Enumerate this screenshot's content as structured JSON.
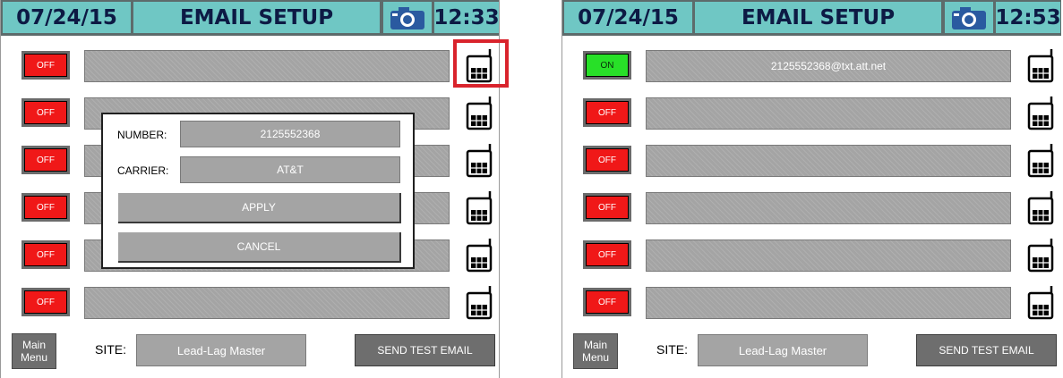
{
  "left": {
    "header": {
      "date": "07/24/15",
      "title": "EMAIL SETUP",
      "time": "12:33",
      "camera_icon": "camera-icon"
    },
    "rows": [
      {
        "state": "OFF",
        "value": ""
      },
      {
        "state": "OFF",
        "value": ""
      },
      {
        "state": "OFF",
        "value": ""
      },
      {
        "state": "OFF",
        "value": ""
      },
      {
        "state": "OFF",
        "value": ""
      },
      {
        "state": "OFF",
        "value": ""
      }
    ],
    "dialog": {
      "number_label": "NUMBER:",
      "number_value": "2125552368",
      "carrier_label": "CARRIER:",
      "carrier_value": "AT&T",
      "apply_label": "APPLY",
      "cancel_label": "CANCEL"
    },
    "footer": {
      "main_menu_line1": "Main",
      "main_menu_line2": "Menu",
      "site_label": "SITE:",
      "site_value": "Lead-Lag Master",
      "send_test_label": "SEND TEST EMAIL"
    }
  },
  "right": {
    "header": {
      "date": "07/24/15",
      "title": "EMAIL SETUP",
      "time": "12:53",
      "camera_icon": "camera-icon"
    },
    "rows": [
      {
        "state": "ON",
        "value": "2125552368@txt.att.net"
      },
      {
        "state": "OFF",
        "value": ""
      },
      {
        "state": "OFF",
        "value": ""
      },
      {
        "state": "OFF",
        "value": ""
      },
      {
        "state": "OFF",
        "value": ""
      },
      {
        "state": "OFF",
        "value": ""
      }
    ],
    "footer": {
      "main_menu_line1": "Main",
      "main_menu_line2": "Menu",
      "site_label": "SITE:",
      "site_value": "Lead-Lag Master",
      "send_test_label": "SEND TEST EMAIL"
    }
  },
  "colors": {
    "off": "#f01818",
    "on": "#28e028",
    "header_bg": "#6fc7c4",
    "highlight": "#d9232c"
  }
}
